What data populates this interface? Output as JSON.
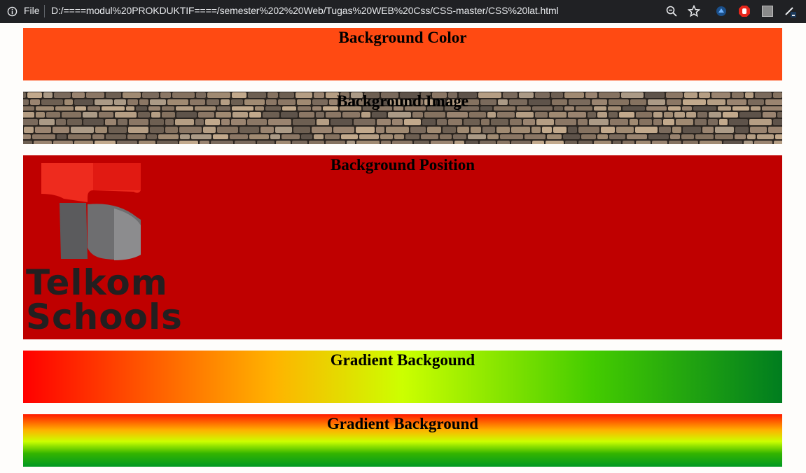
{
  "browser": {
    "file_label": "File",
    "url": "D:/====modul%20PROKDUKTIF====/semester%202%20Web/Tugas%20WEB%20Css/CSS-master/CSS%20lat.html",
    "icons": [
      "info-icon",
      "zoom-icon",
      "star-icon",
      "extension-icon",
      "adblock-icon",
      "extension-square-icon",
      "pen-icon"
    ]
  },
  "sections": {
    "color": {
      "heading": "Background Color",
      "bg": "#ff4a12"
    },
    "image": {
      "heading": "Background Image"
    },
    "position": {
      "heading": "Background Position",
      "bg": "#bf0000",
      "logo_line1": "Telkom",
      "logo_line2": "Schools"
    },
    "gradient_h": {
      "heading": "Gradient Backgound"
    },
    "gradient_v": {
      "heading": "Gradient Background"
    }
  }
}
